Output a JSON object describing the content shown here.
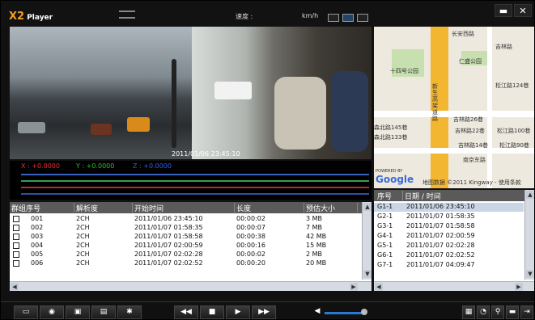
{
  "app": {
    "title_x2": "X2",
    "title_rest": " Player",
    "speed_label": "速度 :",
    "speed_unit": "km/h",
    "video_timestamp": "2011/01/06  23:45:10"
  },
  "sensor": {
    "x": "X : +0.0000",
    "y": "Y : +0.0000",
    "z": "Z : +0.0000"
  },
  "map": {
    "labels": [
      "十四号公园",
      "仁盛公园",
      "吉林路",
      "松江路124巷",
      "长安西路",
      "新生高架道路",
      "森北路145巷",
      "森北路133巷",
      "吉林路26巷",
      "吉林路22巷",
      "吉林路14巷",
      "松江路100巷",
      "松江路90巷",
      "南京东路"
    ],
    "footer": "地图数据 ©2011 Kingway - 使用条款",
    "powered": "POWERED BY",
    "google": "Google"
  },
  "group_table": {
    "headers": [
      "群组序号",
      "解析度",
      "开始时间",
      "长度",
      "预估大小"
    ],
    "rows": [
      [
        "001",
        "2CH",
        "2011/01/06 23:45:10",
        "00:00:02",
        "3 MB"
      ],
      [
        "002",
        "2CH",
        "2011/01/07 01:58:35",
        "00:00:07",
        "7 MB"
      ],
      [
        "003",
        "2CH",
        "2011/01/07 01:58:58",
        "00:00:38",
        "42 MB"
      ],
      [
        "004",
        "2CH",
        "2011/01/07 02:00:59",
        "00:00:16",
        "15 MB"
      ],
      [
        "005",
        "2CH",
        "2011/01/07 02:02:28",
        "00:00:02",
        "2 MB"
      ],
      [
        "006",
        "2CH",
        "2011/01/07 02:02:52",
        "00:00:20",
        "20 MB"
      ]
    ]
  },
  "event_table": {
    "headers": [
      "序号",
      "日期 / 时间"
    ],
    "rows": [
      [
        "G1-1",
        "2011/01/06  23:45:10"
      ],
      [
        "G2-1",
        "2011/01/07  01:58:35"
      ],
      [
        "G3-1",
        "2011/01/07  01:58:58"
      ],
      [
        "G4-1",
        "2011/01/07  02:00:59"
      ],
      [
        "G5-1",
        "2011/01/07  02:02:28"
      ],
      [
        "G6-1",
        "2011/01/07  02:02:52"
      ],
      [
        "G7-1",
        "2011/01/07  04:09:47"
      ]
    ]
  },
  "controls": {
    "rew": "◀◀",
    "stop": "■",
    "play": "▶",
    "ff": "▶▶",
    "minimize": "▬",
    "close": "✕"
  },
  "colors": {
    "accent": "#f0a020",
    "select": "#c9d6e6",
    "header": "#5a5a5a"
  }
}
